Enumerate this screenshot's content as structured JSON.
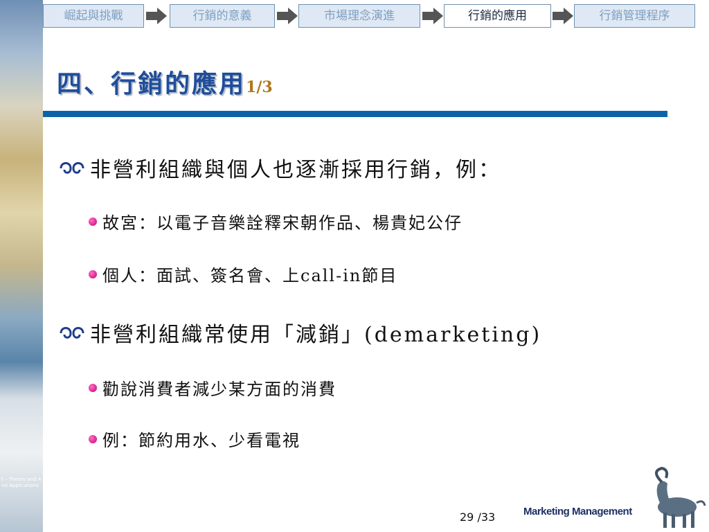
{
  "nav": {
    "tabs": [
      {
        "label": "崛起與挑戰",
        "active": false
      },
      {
        "label": "行銷的意義",
        "active": false
      },
      {
        "label": "市場理念演進",
        "active": false
      },
      {
        "label": "行銷的應用",
        "active": true
      },
      {
        "label": "行銷管理程序",
        "active": false
      }
    ]
  },
  "slide": {
    "title": "四、行銷的應用",
    "title_page": "1/3",
    "bullets": [
      {
        "level": 1,
        "text": "非營利組織與個人也逐漸採用行銷，例："
      },
      {
        "level": 2,
        "text": "故宮：以電子音樂詮釋宋朝作品、楊貴妃公仔"
      },
      {
        "level": 2,
        "text": "個人：面試、簽名會、上call-in節目"
      },
      {
        "level": 1,
        "text": "非營利組織常使用「減銷」(demarketing)"
      },
      {
        "level": 2,
        "text": "勸說消費者減少某方面的消費"
      },
      {
        "level": 2,
        "text": "例：節約用水、少看電視"
      }
    ]
  },
  "sidebar": {
    "lines": [
      "t – Theory and A",
      "nd Applications"
    ]
  },
  "footer": {
    "page_number": "29",
    "page_total": "/33",
    "brand": "Marketing Management"
  },
  "colors": {
    "nav_active_bg": "#ffffff",
    "nav_inactive_bg": "#dfe9f5",
    "title": "#1f4d9a",
    "title_bar": "#0c63a9",
    "bullet2": "#c4007a"
  }
}
